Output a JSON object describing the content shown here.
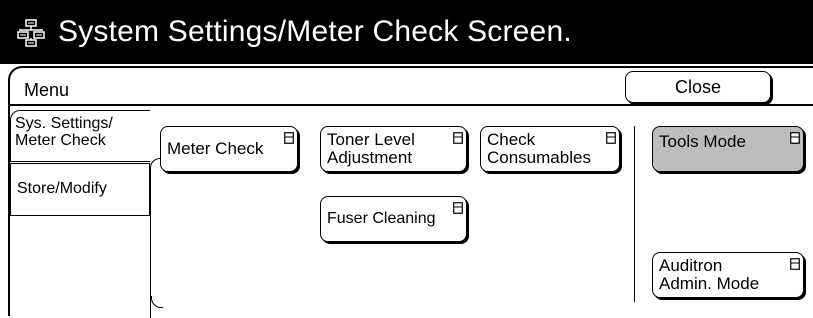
{
  "window": {
    "title": "System Settings/Meter Check Screen.",
    "icon": "printer-system-icon"
  },
  "header": {
    "menu_label": "Menu",
    "close_label": "Close"
  },
  "tabs": [
    {
      "label": "Sys. Settings/\nMeter Check",
      "selected": true
    },
    {
      "label": "Store/Modify",
      "selected": false
    }
  ],
  "buttons": {
    "meter_check": "Meter Check",
    "toner_level": "Toner Level\nAdjustment",
    "check_consumables": "Check\nConsumables",
    "fuser_cleaning": "Fuser Cleaning",
    "tools_mode": "Tools Mode",
    "auditron_admin": "Auditron\nAdmin. Mode"
  },
  "colors": {
    "titlebar": "#000000",
    "selected_button": "#bdbdbd"
  }
}
